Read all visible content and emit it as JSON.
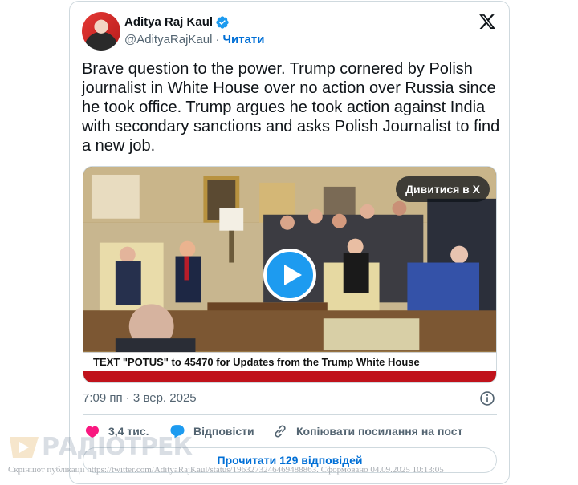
{
  "tweet": {
    "author_name": "Aditya Raj Kaul",
    "handle": "@AdityaRajKaul",
    "separator": "·",
    "follow_label": "Читати",
    "text": "Brave question to the power. Trump cornered by Polish journalist in White House over no action over Russia since he took office. Trump argues he took action against India with secondary sanctions and asks Polish Journalist to find a new job.",
    "timestamp": "7:09 пп · 3 вер. 2025"
  },
  "media": {
    "watch_label": "Дивитися в X",
    "ticker_text": "TEXT \"POTUS\" to 45470 for Updates from the Trump White House"
  },
  "actions": {
    "like_count": "3,4 тис.",
    "reply_label": "Відповісти",
    "copy_label": "Копіювати посилання на пост"
  },
  "read_replies_label": "Прочитати 129 відповідей",
  "watermark": {
    "brand": "РАДІОТРЕК",
    "caption": "Скріншот публікації https://twitter.com/AdityaRajKaul/status/1963273246469488863. Сформовано 04.09.2025 10:13:05"
  },
  "colors": {
    "verified": "#1d9bf0",
    "link": "#006fd6",
    "like": "#f91880",
    "ticker_red": "#c0121b"
  },
  "icons": [
    "verified-badge-icon",
    "x-logo-icon",
    "play-icon",
    "info-icon",
    "heart-icon",
    "reply-bubble-icon",
    "link-icon"
  ]
}
